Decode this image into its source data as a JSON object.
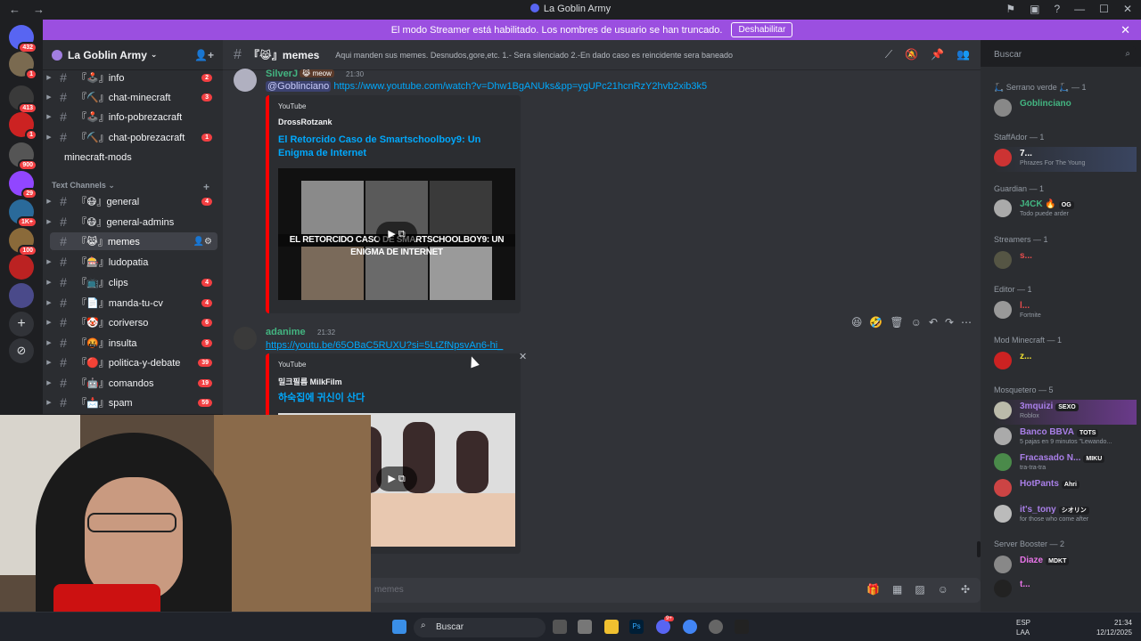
{
  "window": {
    "title": "La Goblin Army"
  },
  "banner": {
    "text": "El modo Streamer está habilitado. Los nombres de usuario se han truncado.",
    "button": "Deshabilitar"
  },
  "servers": [
    {
      "badge": "432"
    },
    {
      "badge": "1"
    },
    {
      "badge": "413"
    },
    {
      "badge": "1"
    },
    {
      "badge": "900"
    },
    {
      "badge": "29"
    },
    {
      "badge": "1K+"
    },
    {
      "badge": "100"
    },
    {
      "badge": ""
    },
    {
      "badge": ""
    }
  ],
  "sidebar": {
    "guild": "La Goblin Army",
    "channels_top": [
      {
        "name": "『🕹️』info",
        "count": "2"
      },
      {
        "name": "『⛏️』chat-minecraft",
        "count": "3"
      },
      {
        "name": "『🕹️』info-pobrezacraft",
        "count": ""
      },
      {
        "name": "『⛏️』chat-pobrezacraft",
        "count": "1"
      },
      {
        "name": "minecraft-mods",
        "count": ""
      }
    ],
    "category": "Text Channels",
    "channels": [
      {
        "name": "『😷』general",
        "count": "4"
      },
      {
        "name": "『😷』general-admins",
        "count": ""
      },
      {
        "name": "『😹』memes",
        "count": ""
      },
      {
        "name": "『🎰』ludopatia",
        "count": ""
      },
      {
        "name": "『📺』clips",
        "count": "4"
      },
      {
        "name": "『📄』manda-tu-cv",
        "count": "4"
      },
      {
        "name": "『🤡』coriverso",
        "count": "6"
      },
      {
        "name": "『🤬』insulta",
        "count": "9"
      },
      {
        "name": "『🔴』politica-y-debate",
        "count": "39"
      },
      {
        "name": "『🤖』comandos",
        "count": "19"
      },
      {
        "name": "『📩』spam",
        "count": "59"
      }
    ]
  },
  "header": {
    "channel": "『😹』memes",
    "topic": "Aqui manden sus memes. Desnudos,gore,etc. 1.- Sera silenciado 2.-En dado caso es reincidente sera baneado",
    "search_placeholder": "Buscar"
  },
  "messages": [
    {
      "author": "SilverJ",
      "tag": "😹 meow",
      "time": "21:30",
      "mention": "@Goblinciano",
      "link": "https://www.youtube.com/watch?v=Dhw1BgANUks&pp=ygUPc21hcnRzY2hvb2xib3k5",
      "embed": {
        "provider": "YouTube",
        "author": "DrossRotzank",
        "title": "El Retorcido Caso de Smartschoolboy9: Un Enigma de Internet",
        "thumb_text": "EL RETORCIDO CASO DE SMARTSCHOOLBOY9: UN ENIGMA DE INTERNET"
      }
    },
    {
      "author": "adanime",
      "time": "21:32",
      "link": "https://youtu.be/65OBaC5RUXU?si=5LtZfNpsvAn6-hi_",
      "embed": {
        "provider": "YouTube",
        "author": "밀크필름 MilkFilm",
        "title": "하숙집에 귀신이 산다"
      }
    }
  ],
  "composer": {
    "placeholder": "memes"
  },
  "members": {
    "roles": [
      {
        "name": "🛴 Serrano verde 🛴 — 1"
      },
      {
        "name": "StaffAdor — 1"
      },
      {
        "name": "Guardian — 1"
      },
      {
        "name": "Streamers — 1"
      },
      {
        "name": "Editor — 1"
      },
      {
        "name": "Mod Minecraft — 1"
      },
      {
        "name": "Mosquetero — 5"
      },
      {
        "name": "Server Booster — 2"
      }
    ],
    "list": [
      {
        "name": "Goblinciano",
        "status": "",
        "tag": "",
        "color": "#43b581"
      },
      {
        "name": "7...",
        "status": "Phrazes For The Young",
        "tag": "",
        "color": "#ffffff"
      },
      {
        "name": "J4CK 🔥",
        "status": "Todo puede arder",
        "tag": "OG",
        "color": "#43b581"
      },
      {
        "name": "s...",
        "status": "",
        "tag": "",
        "color": "#e84d4d"
      },
      {
        "name": "l...",
        "status": "Fortnite",
        "tag": "",
        "color": "#e84d4d"
      },
      {
        "name": "z...",
        "status": "",
        "tag": "",
        "color": "#f0e130"
      },
      {
        "name": "3mquizi",
        "status": "Roblox",
        "tag": "SEXO",
        "color": "#a97fe8"
      },
      {
        "name": "Banco BBVA",
        "status": "5 pajas en 9 minutos \"Lewando...",
        "tag": "TOTS",
        "color": "#a97fe8"
      },
      {
        "name": "Fracasado N...",
        "status": "tra-tra-tra",
        "tag": "MIKU",
        "color": "#a97fe8"
      },
      {
        "name": "HotPants",
        "status": "",
        "tag": "Ahri",
        "color": "#a97fe8"
      },
      {
        "name": "it's_tony",
        "status": "for those who come after",
        "tag": "シオリン",
        "color": "#a97fe8"
      },
      {
        "name": "Diaze",
        "status": "",
        "tag": "MDKT",
        "color": "#e874e8"
      },
      {
        "name": "t...",
        "status": "",
        "tag": "",
        "color": "#e874e8"
      }
    ]
  },
  "taskbar": {
    "search": "Buscar",
    "lang": "ESP",
    "lang2": "LAA",
    "time": "21:34",
    "date": "12/12/2025",
    "discord_badge": "9+"
  }
}
